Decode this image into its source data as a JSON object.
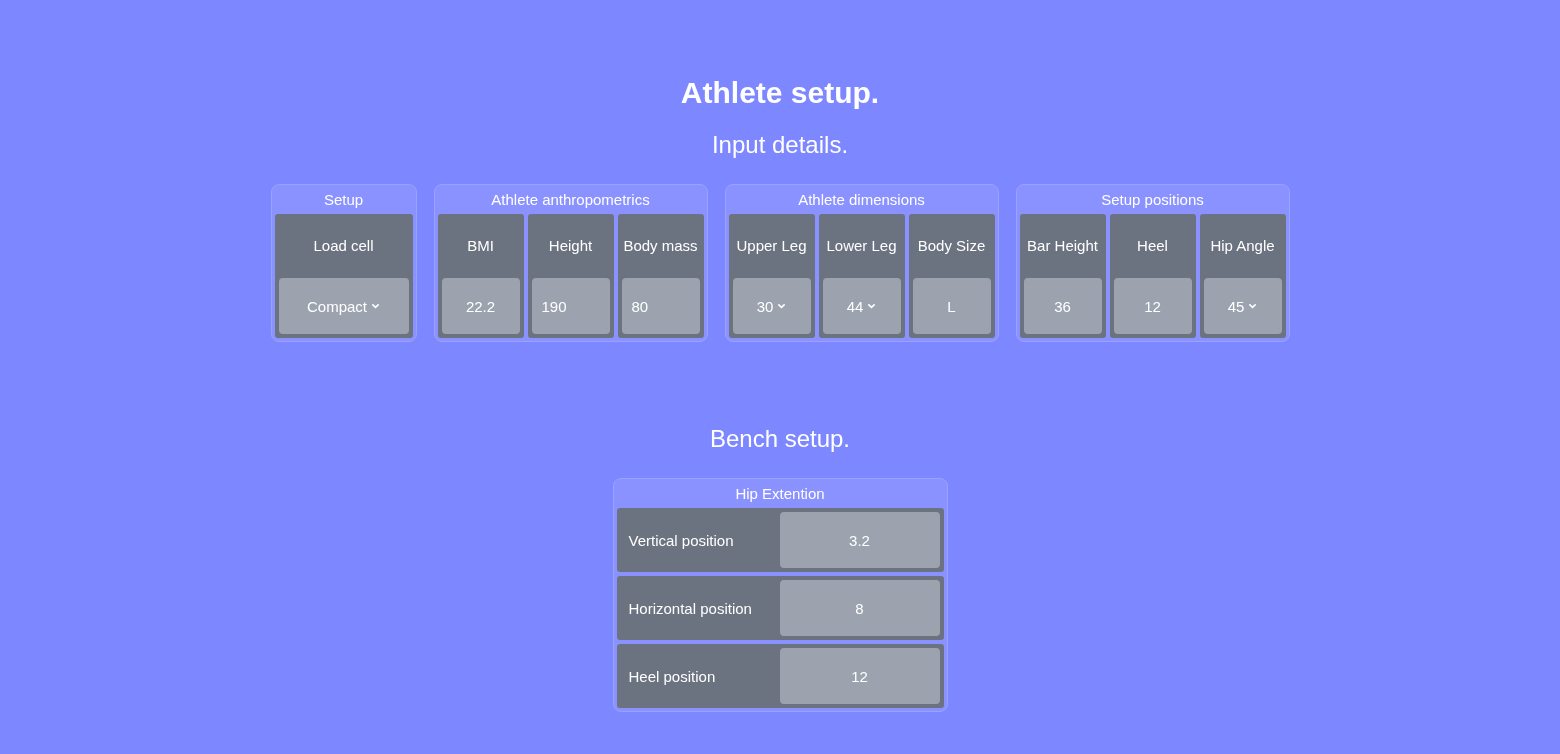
{
  "title": "Athlete setup.",
  "input_heading": "Input details.",
  "groups": [
    {
      "title": "Setup",
      "fields": [
        {
          "label": "Load cell",
          "kind": "select",
          "value": "Compact"
        }
      ]
    },
    {
      "title": "Athlete anthropometrics",
      "fields": [
        {
          "label": "BMI",
          "kind": "display",
          "value": "22.2"
        },
        {
          "label": "Height",
          "kind": "input",
          "value": "190"
        },
        {
          "label": "Body mass",
          "kind": "input",
          "value": "80"
        }
      ]
    },
    {
      "title": "Athlete dimensions",
      "fields": [
        {
          "label": "Upper Leg",
          "kind": "select",
          "value": "30"
        },
        {
          "label": "Lower Leg",
          "kind": "select",
          "value": "44"
        },
        {
          "label": "Body Size",
          "kind": "display",
          "value": "L"
        }
      ]
    },
    {
      "title": "Setup positions",
      "fields": [
        {
          "label": "Bar Height",
          "kind": "display",
          "value": "36"
        },
        {
          "label": "Heel",
          "kind": "display",
          "value": "12"
        },
        {
          "label": "Hip Angle",
          "kind": "select",
          "value": "45"
        }
      ]
    }
  ],
  "bench_heading": "Bench setup.",
  "bench": {
    "title": "Hip Extention",
    "rows": [
      {
        "label": "Vertical position",
        "value": "3.2"
      },
      {
        "label": "Horizontal position",
        "value": "8"
      },
      {
        "label": "Heel position",
        "value": "12"
      }
    ]
  }
}
